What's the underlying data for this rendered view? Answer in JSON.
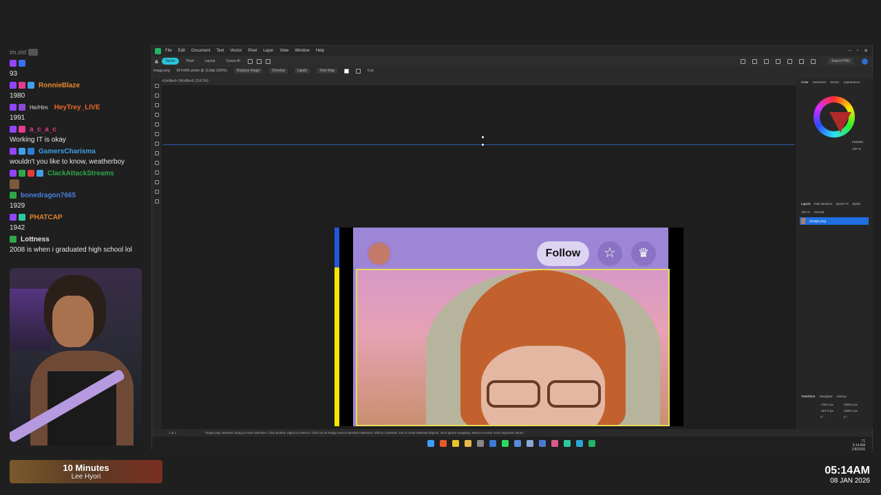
{
  "chat": {
    "messages": [
      {
        "user": "im.old",
        "text": ""
      },
      {
        "user": "",
        "text": "93"
      },
      {
        "user": "RonnieBlaze",
        "color": "#e58a2f",
        "text": "1980"
      },
      {
        "user": "HeyTrey_LIVE",
        "color": "#e86a2a",
        "pronoun": "He/Him",
        "text": "1991"
      },
      {
        "user": "a_c_a_c",
        "color": "#e53a8e",
        "text": "Working IT is okay"
      },
      {
        "user": "GamersCharisma",
        "color": "#3fa0e8",
        "text": "wouldn't you like to know, weatherboy"
      },
      {
        "user": "ClackAttackStreams",
        "color": "#2ea84a",
        "text": ""
      },
      {
        "user": "bonedragon7665",
        "color": "#4a7fe0",
        "text": "1929"
      },
      {
        "user": "PHATCAP",
        "color": "#e5832f",
        "text": "1942"
      },
      {
        "user": "Lottness",
        "color": "#e6e6e6",
        "text": "2008 is when i graduated high school lol"
      }
    ]
  },
  "song": {
    "title": "10 Minutes",
    "artist": "Lee Hyori"
  },
  "clock": {
    "time": "05:14AM",
    "date": "08 JAN 2026"
  },
  "app": {
    "menu": [
      "File",
      "Edit",
      "Document",
      "Text",
      "Vector",
      "Pixel",
      "Layer",
      "View",
      "Window",
      "Help"
    ],
    "personas": [
      "Vector",
      "Pixel",
      "Layout",
      "Canva AI"
    ],
    "export_label": "Export PNG",
    "context": {
      "filename": "Image.png",
      "info": "897x906 pixels @ 113dpi (265%)",
      "buttons": [
        "Replace image",
        "Develop",
        "Liquify",
        "Tone Map"
      ],
      "stroke": "0 pt"
    },
    "doc_tab": "<Untitled> (Modified) (114.5%)",
    "right_tabs": [
      "Color",
      "Swatches",
      "Stroke",
      "Appearance"
    ],
    "hex_value": "FB0808",
    "opacity_readout": "100 %",
    "layer_tabs": [
      "Layers",
      "Path Brushes",
      "Quick FX",
      "Styles"
    ],
    "layer_opacity": "100 %",
    "blend_mode": "Normal",
    "layer_name": "(Image.png)",
    "transform_tabs": [
      "Transform",
      "Navigator",
      "History"
    ],
    "transform": {
      "x": "-726.2 px",
      "y": "-257.8 px",
      "w": "2369.5 px",
      "h": "2395.3 px",
      "r": "0 °",
      "s": "0 °"
    },
    "status": "'Image.png' selected. Drag to move selection. Click another object to select it. Click on an empty area to deselect selection. Shift to constrain. Ctrl to clone selected objects. Alt to ignore snapping. Return to enter more duplicate values.",
    "page": "1 of 1",
    "tray_time": "5:14 AM",
    "tray_date": "1/8/2026",
    "tray_num": "71"
  },
  "canvas_content": {
    "follow_label": "Follow",
    "star_glyph": "☆",
    "bell_glyph": "♛"
  }
}
